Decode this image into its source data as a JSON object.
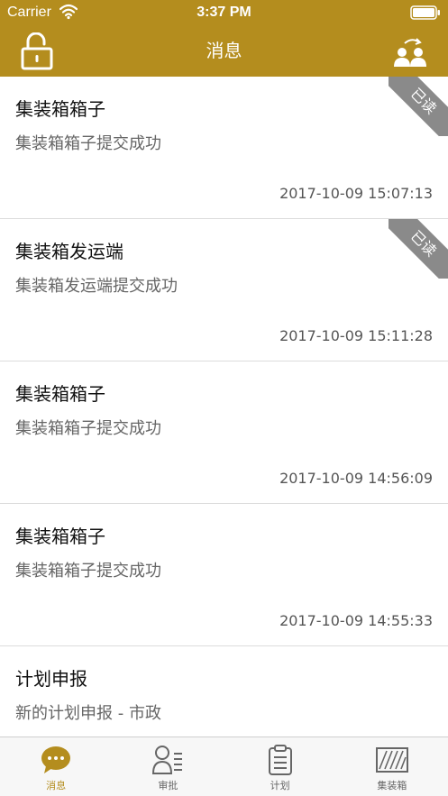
{
  "status_bar": {
    "carrier": "Carrier",
    "time": "3:37 PM",
    "icons": [
      "wifi-icon",
      "battery-icon"
    ]
  },
  "nav": {
    "title": "消息",
    "left_icon": "unlock-icon",
    "right_icon": "switch-users-icon"
  },
  "colors": {
    "brand": "#b48d1e",
    "badge": "#8a8a8a",
    "text_primary": "#111111",
    "text_secondary": "#666666",
    "divider": "#dcdcdc"
  },
  "messages": [
    {
      "title": "集装箱箱子",
      "subtitle": "集装箱箱子提交成功",
      "time": "2017-10-09 15:07:13",
      "badge": "已读"
    },
    {
      "title": "集装箱发运端",
      "subtitle": "集装箱发运端提交成功",
      "time": "2017-10-09 15:11:28",
      "badge": "已读"
    },
    {
      "title": "集装箱箱子",
      "subtitle": "集装箱箱子提交成功",
      "time": "2017-10-09 14:56:09",
      "badge": ""
    },
    {
      "title": "集装箱箱子",
      "subtitle": "集装箱箱子提交成功",
      "time": "2017-10-09 14:55:33",
      "badge": ""
    },
    {
      "title": "计划申报",
      "subtitle": "新的计划申报 - 市政",
      "time": "",
      "badge": ""
    }
  ],
  "tabs": [
    {
      "label": "消息",
      "icon": "chat-bubble-icon",
      "active": true
    },
    {
      "label": "审批",
      "icon": "approval-user-icon",
      "active": false
    },
    {
      "label": "计划",
      "icon": "clipboard-icon",
      "active": false
    },
    {
      "label": "集装箱",
      "icon": "container-icon",
      "active": false
    }
  ]
}
